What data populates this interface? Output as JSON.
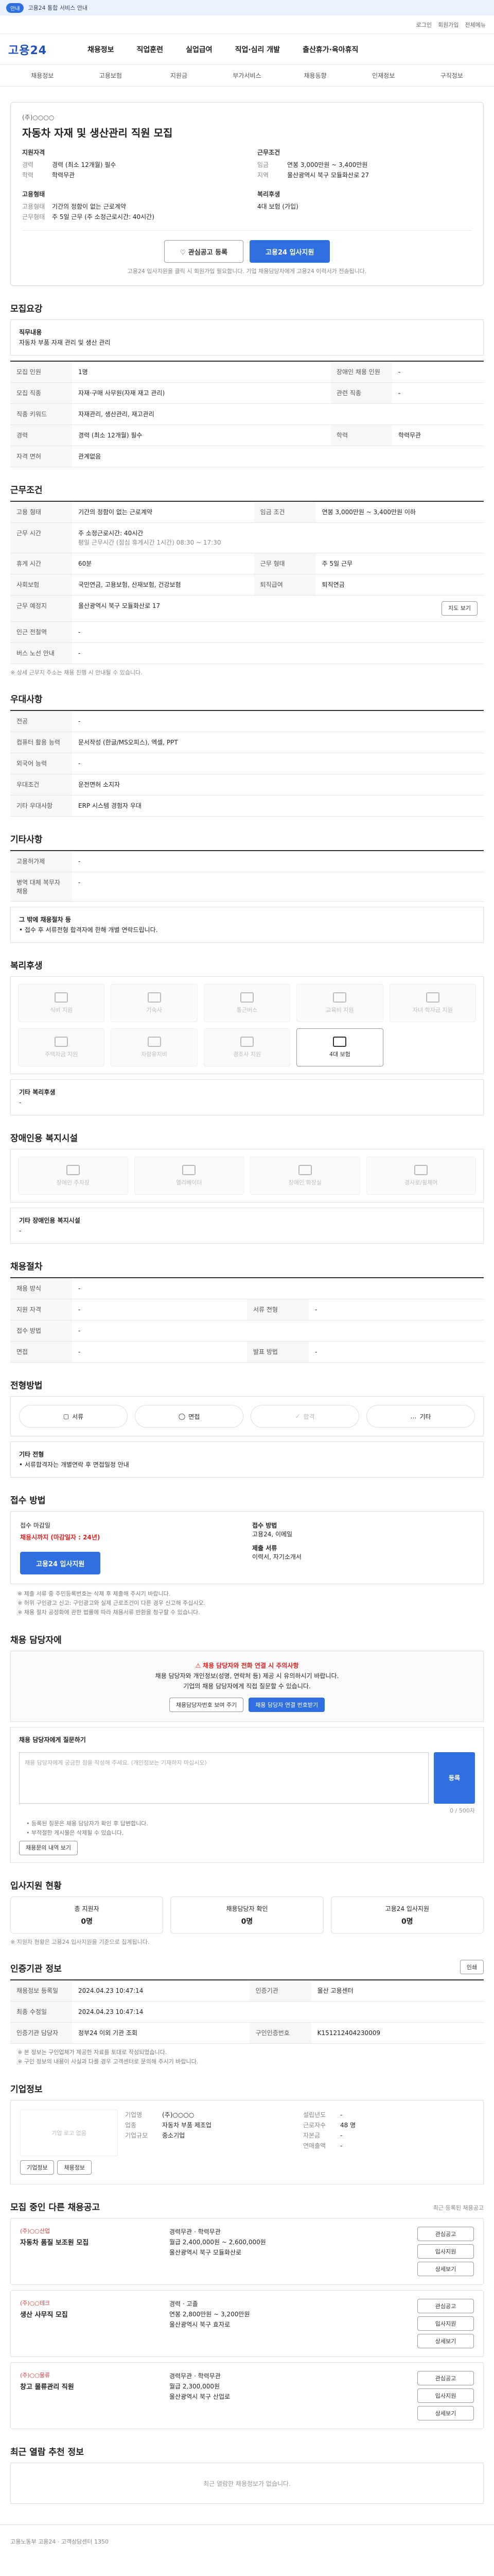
{
  "banner": {
    "badge": "안내",
    "text": "고용24 통합 서비스 안내"
  },
  "util": {
    "login": "로그인",
    "join": "회원가입",
    "sitemap": "전체메뉴"
  },
  "gnb": {
    "logo": "고용24",
    "menus": [
      "채용정보",
      "직업훈련",
      "실업급여",
      "직업·심리 개발",
      "출산휴가·육아휴직"
    ]
  },
  "subnav": [
    "채용정보",
    "고용보험",
    "지원금",
    "부가서비스",
    "채용동향",
    "인재정보",
    "구직정보"
  ],
  "summary": {
    "company": "(주)○○○○",
    "title": "자동차 자재 및 생산관리 직원 모집",
    "left_head": "지원자격",
    "left_rows": [
      {
        "k": "경력",
        "v": "경력 (최소 12개월) 필수"
      },
      {
        "k": "학력",
        "v": "학력무관"
      }
    ],
    "right_head": "근무조건",
    "right_rows": [
      {
        "k": "임금",
        "v": "연봉 3,000만원 ~ 3,400만원"
      },
      {
        "k": "지역",
        "v": "울산광역시 북구 모듈화산로 27"
      }
    ],
    "left_head2": "고용형태",
    "left_rows2": [
      {
        "k": "고용형태",
        "v": "기간의 정함이 없는 근로계약"
      },
      {
        "k": "근무형태",
        "v": "주 5일 근무 (주 소정근로시간: 40시간)"
      }
    ],
    "right_head2": "복리후생",
    "right_rows2": [
      {
        "k": "",
        "v": "4대 보험 (가입)"
      }
    ],
    "btn_scrap": "♡ 관심공고 등록",
    "btn_apply": "고용24 입사지원",
    "note": "고용24 입사지원을 클릭 시 회원가입 필요합니다. 기업 채용담당자에게 고용24 이력서가 전송됩니다."
  },
  "sec_recruit": {
    "title": "모집요강",
    "duty_head": "직무내용",
    "duty_text": "자동차 부품 자재 관리 및 생산 관리",
    "rows": [
      [
        "모집 인원",
        "1명",
        "장애인 채용 인원",
        "-"
      ],
      [
        "모집 직종",
        "자재·구매 사무원(자재 재고 관리)",
        "관련 직종",
        "-"
      ],
      [
        "직종 키워드",
        "자재관리, 생산관리, 재고관리",
        "",
        ""
      ],
      [
        "경력",
        "경력 (최소 12개월) 필수",
        "학력",
        "학력무관"
      ],
      [
        "자격 면허",
        "관계없음",
        "",
        ""
      ]
    ]
  },
  "sec_cond": {
    "title": "근무조건",
    "rows": [
      [
        "고용 형태",
        "기간의 정함이 없는 근로계약",
        "임금 조건",
        "연봉 3,000만원 ~ 3,400만원 이하"
      ],
      [
        "근무 시간",
        "주 소정근로시간: 40시간",
        "",
        ""
      ],
      [
        "",
        "평일 근무시간 (점심 휴게시간 1시간) 08:30 ~ 17:30",
        "",
        ""
      ],
      [
        "휴게 시간",
        "60분",
        "근무 형태",
        "주 5일 근무"
      ],
      [
        "사회보험",
        "국민연금, 고용보험, 산재보험, 건강보험",
        "퇴직급여",
        "퇴직연금"
      ],
      [
        "근무 예정지",
        "울산광역시 북구 모듈화산로 17",
        "",
        ""
      ],
      [
        "인근 전철역",
        "-",
        "",
        ""
      ],
      [
        "버스 노선 안내",
        "-",
        "",
        ""
      ]
    ],
    "map_btn": "지도 보기",
    "note": "※ 상세 근무지 주소는 채용 진행 시 안내될 수 있습니다."
  },
  "sec_extra": {
    "title": "우대사항",
    "rows": [
      [
        "전공",
        "-"
      ],
      [
        "컴퓨터 활용 능력",
        "문서작성 (한글/MS오피스), 엑셀, PPT"
      ],
      [
        "외국어 능력",
        "-"
      ],
      [
        "우대조건",
        "운전면허 소지자"
      ],
      [
        "기타 우대사항",
        "ERP 시스템 경험자 우대"
      ]
    ]
  },
  "sec_other": {
    "title": "기타사항",
    "rows": [
      [
        "고용허가제",
        "-"
      ],
      [
        "병역 대체 복무자 채용",
        "-"
      ]
    ],
    "text1": "그 밖에 채용절차 등",
    "text2": "• 접수 후 서류전형 합격자에 한해 개별 연락드립니다."
  },
  "sec_welfare": {
    "title": "복리후생",
    "items": [
      {
        "label": "식비 지원",
        "on": false
      },
      {
        "label": "기숙사",
        "on": false
      },
      {
        "label": "통근버스",
        "on": false
      },
      {
        "label": "교육비 지원",
        "on": false
      },
      {
        "label": "자녀 학자금 지원",
        "on": false
      },
      {
        "label": "주택자금 지원",
        "on": false
      },
      {
        "label": "차량유지비",
        "on": false
      },
      {
        "label": "경조사 지원",
        "on": false
      },
      {
        "label": "4대 보험",
        "on": true
      }
    ],
    "etc_head": "기타 복리후생",
    "etc_val": "-"
  },
  "sec_disabled": {
    "title": "장애인용 복지시설",
    "items": [
      "장애인 주차장",
      "엘리베이터",
      "장애인 화장실",
      "경사로/휠체어"
    ],
    "etc_head": "기타 장애인용 복지시설",
    "etc_val": "-"
  },
  "sec_process": {
    "title": "채용절차",
    "rows": [
      [
        "채용 방식",
        "-",
        "",
        ""
      ],
      [
        "지원 자격",
        "-",
        "서류 전형",
        "-"
      ],
      [
        "접수 방법",
        "-",
        "",
        ""
      ],
      [
        "면접",
        "-",
        "발표 방법",
        "-"
      ]
    ]
  },
  "sec_steps": {
    "title": "전형방법",
    "steps": [
      "서류",
      "면접",
      "합격",
      "기타"
    ],
    "text_head": "기타 전형",
    "text": "• 서류합격자는 개별연락 후 면접일정 안내"
  },
  "sec_apply": {
    "title": "접수 방법",
    "deadline_label": "접수 마감일",
    "deadline": "채용시까지 (마감일자 : 24년)",
    "method_label": "접수 방법",
    "method": "고용24, 이메일",
    "docs_label": "제출 서류",
    "docs": "이력서, 자기소개서",
    "apply_btn": "고용24 입사지원",
    "notes": [
      "※ 제출 서류 중 주민등록번호는 삭제 후 제출해 주시기 바랍니다.",
      "※ 허위 구인광고 신고: 구인광고와 실제 근로조건이 다른 경우 신고해 주십시오.",
      "※ 채용 절차 공정화에 관한 법률에 따라 채용서류 반환을 청구할 수 있습니다."
    ]
  },
  "sec_contact": {
    "title": "채용 담당자에",
    "warn_title": "채용 담당자와 전화 연결 시 주의사항",
    "warn1": "채용 담당자와 개인정보(성명, 연락처 등) 제공 시 유의하시기 바랍니다.",
    "warn2": "기업의 채용 담당자에게 직접 질문할 수 있습니다.",
    "btn_phone": "채용담당자번호 보여 주기",
    "btn_qna": "채용 담당자 연결 번호받기",
    "qna_head": "채용 담당자에게 질문하기",
    "placeholder": "채용 담당자에게 궁금한 점을 작성해 주세요. (개인정보는 기재하지 마십시오)",
    "count": "0 / 500자",
    "reg_btn": "등록",
    "qna_notes": [
      "• 등록된 질문은 채용 담당자가 확인 후 답변합니다.",
      "• 부적절한 게시물은 삭제될 수 있습니다."
    ],
    "my_btn": "채용문의 내역 보기"
  },
  "sec_stat": {
    "title": "입사지원 현황",
    "stats": [
      {
        "label": "총 지원자",
        "val": "0명"
      },
      {
        "label": "채용담당자 확인",
        "val": "0명"
      },
      {
        "label": "고용24 입사지원",
        "val": "0명"
      }
    ],
    "note": "※ 지원자 현황은 고용24 입사지원을 기준으로 집계됩니다."
  },
  "sec_info": {
    "title": "인증기관 정보",
    "print_btn": "인쇄",
    "rows": [
      [
        "채용정보 등록일",
        "2024.04.23 10:47:14",
        "인증기관",
        "울산 고용센터"
      ],
      [
        "최종 수정일",
        "2024.04.23 10:47:14",
        "",
        ""
      ],
      [
        "인증기관 담당자",
        "정부24 이외 기관 조회",
        "구인인증번호",
        "K151212404230009"
      ]
    ],
    "notes": [
      "※ 본 정보는 구인업체가 제공한 자료를 토대로 작성되었습니다.",
      "※ 구인 정보의 내용이 사실과 다를 경우 고객센터로 문의해 주시기 바랍니다."
    ]
  },
  "sec_corp": {
    "title": "기업정보",
    "logo_text": "기업 로고 없음",
    "left": [
      [
        "기업명",
        "(주)○○○○"
      ],
      [
        "업종",
        "자동차 부품 제조업"
      ],
      [
        "기업규모",
        "중소기업"
      ]
    ],
    "right": [
      [
        "설립년도",
        "-"
      ],
      [
        "근로자수",
        "48 명"
      ],
      [
        "자본금",
        "-"
      ],
      [
        "연매출액",
        "-"
      ]
    ],
    "btn_info": "기업정보",
    "btn_more": "채용정보"
  },
  "sec_related": {
    "title": "모집 중인 다른 채용공고",
    "sub": "최근 등록된 채용공고",
    "items": [
      {
        "co": "(주)○○산업",
        "title": "자동차 품질 보조원 모집",
        "d1": "경력무관 · 학력무관",
        "d2": "월급 2,400,000원 ~ 2,600,000원",
        "d3": "울산광역시 북구 모듈화산로"
      },
      {
        "co": "(주)○○테크",
        "title": "생산 사무직 모집",
        "d1": "경력 · 고졸",
        "d2": "연봉 2,800만원 ~ 3,200만원",
        "d3": "울산광역시 북구 효자로"
      },
      {
        "co": "(주)○○물류",
        "title": "창고 물류관리 직원",
        "d1": "경력무관 · 학력무관",
        "d2": "월급 2,300,000원",
        "d3": "울산광역시 북구 산업로"
      }
    ],
    "btn_scrap": "관심공고",
    "btn_apply": "입사지원",
    "btn_detail": "상세보기"
  },
  "sec_recent": {
    "title": "최근 열람 추천 정보",
    "empty": "최근 열람한 채용정보가 없습니다."
  },
  "footer": {
    "text": "고용노동부 고용24 · 고객상담센터 1350"
  }
}
